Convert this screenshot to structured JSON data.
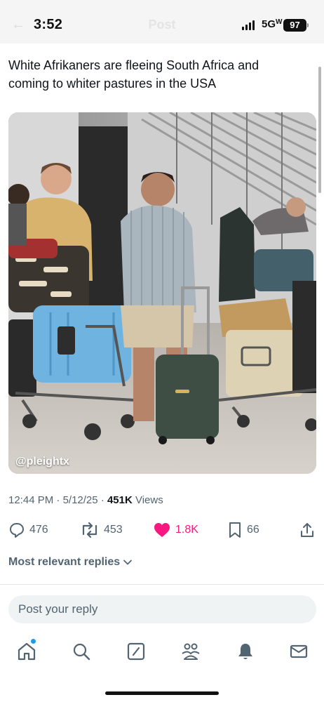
{
  "status_bar": {
    "time": "3:52",
    "network": "5G",
    "network_suffix": "W",
    "battery": "97",
    "ghost_title": "Post"
  },
  "post": {
    "text": "White Afrikaners are fleeing South Africa and coming to whiter pastures in the USA",
    "image": {
      "watermark": "@pleightx",
      "description_icon": "photo-image"
    },
    "meta": {
      "time": "12:44 PM",
      "date": "5/12/25",
      "views_count": "451K",
      "views_label": "Views",
      "separator": "·"
    },
    "actions": {
      "replies": "476",
      "reposts": "453",
      "likes": "1.8K",
      "bookmarks": "66"
    },
    "sort_label": "Most relevant replies"
  },
  "reply": {
    "placeholder": "Post your reply"
  },
  "nav": {
    "items": [
      "home-icon",
      "search-icon",
      "grok-icon",
      "communities-icon",
      "notifications-icon",
      "messages-icon"
    ]
  },
  "colors": {
    "like": "#f91880",
    "accent": "#1d9bf0",
    "secondary_text": "#536471"
  }
}
